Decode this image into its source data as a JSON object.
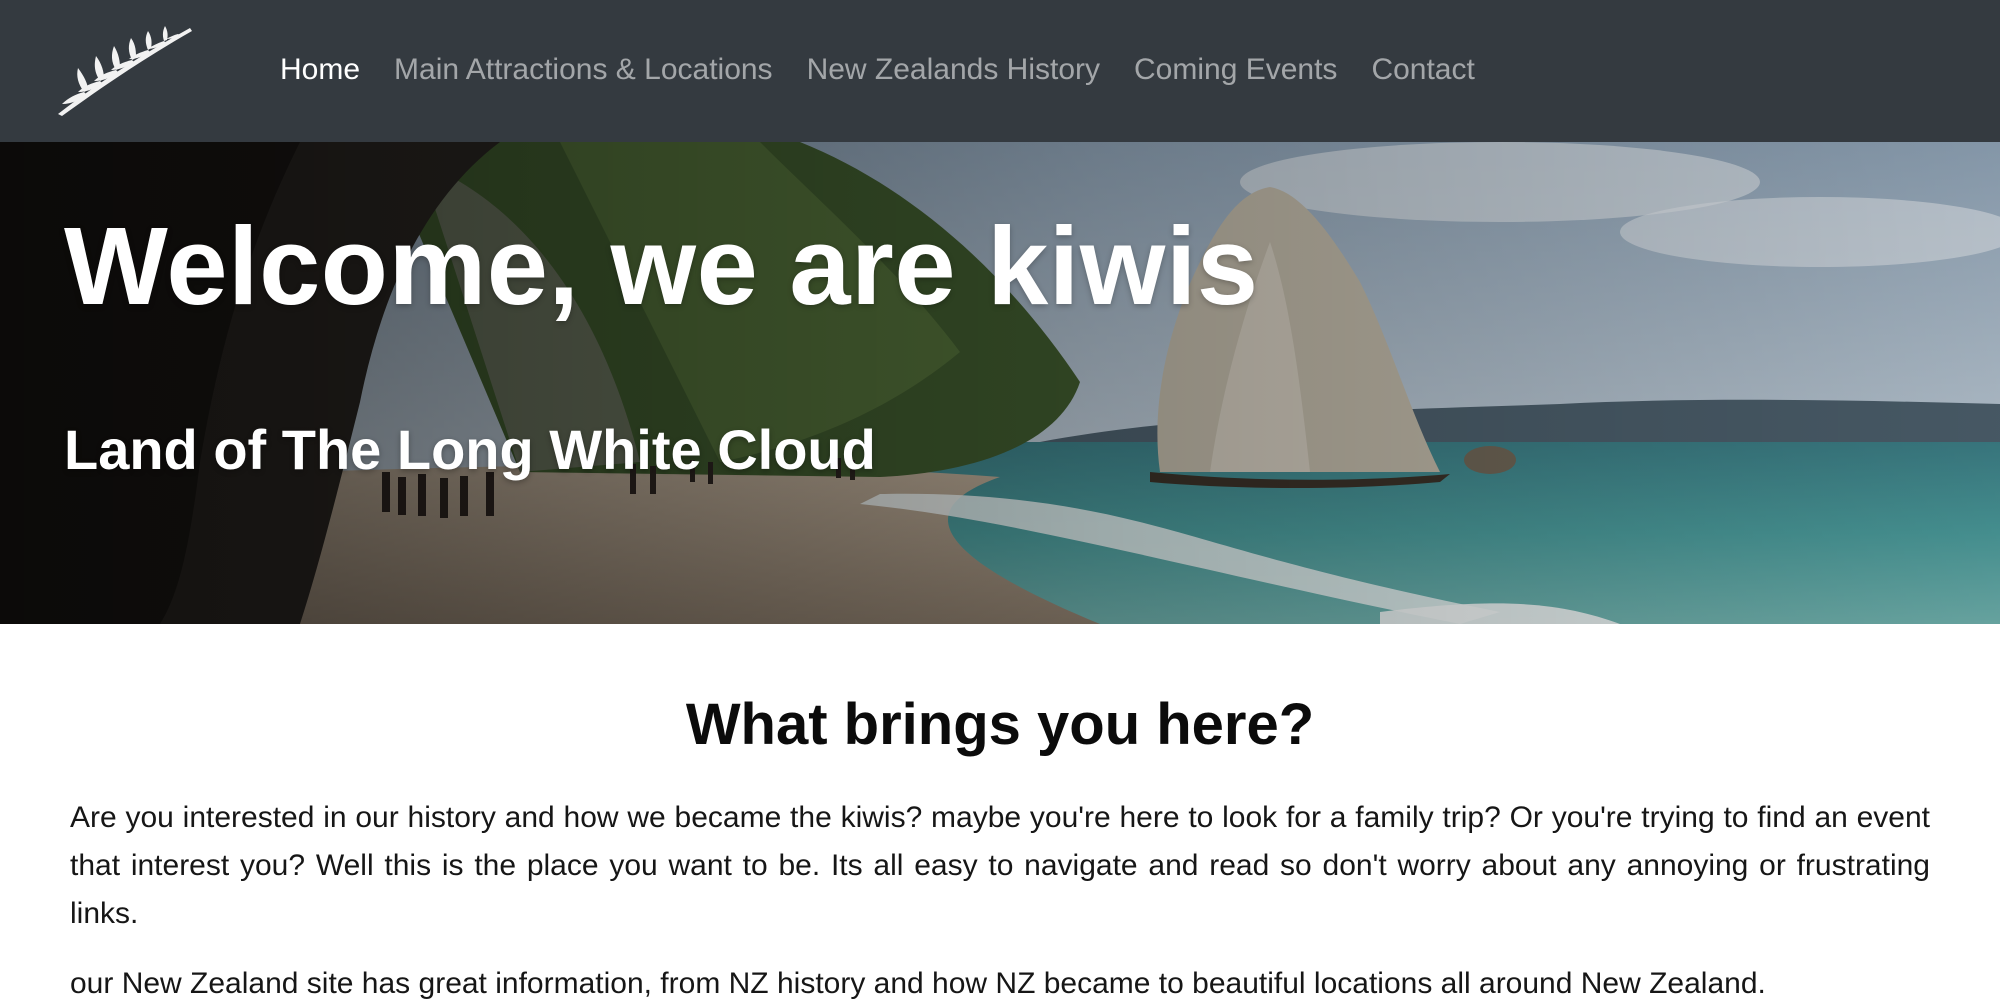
{
  "colors": {
    "navbar_bg": "#343a40",
    "nav_active": "#ffffff",
    "nav_inactive": "#9a9da0"
  },
  "navbar": {
    "logo_icon": "silver-fern-icon",
    "links": [
      {
        "label": "Home",
        "active": true
      },
      {
        "label": "Main Attractions & Locations",
        "active": false
      },
      {
        "label": "New Zealands History",
        "active": false
      },
      {
        "label": "Coming Events",
        "active": false
      },
      {
        "label": "Contact",
        "active": false
      }
    ]
  },
  "hero": {
    "title": "Welcome, we are kiwis",
    "subtitle": "Land of The Long White Cloud"
  },
  "main": {
    "heading": "What brings you here?",
    "paragraphs": [
      "Are you interested in our history and how we became the kiwis? maybe you're here to look for a family trip? Or you're trying to find an event that interest you? Well this is the place you want to be. Its all easy to navigate and read so don't worry about any annoying or frustrating links.",
      "our New Zealand site has great information, from NZ history and how NZ became to beautiful locations all around New Zealand."
    ]
  }
}
